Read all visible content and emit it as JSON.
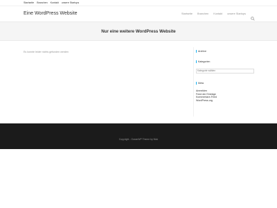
{
  "topbar": {
    "items": [
      {
        "label": "Startseite"
      },
      {
        "label": "Branchen"
      },
      {
        "label": "Kontakt"
      },
      {
        "label": "unsere Startups"
      }
    ]
  },
  "header": {
    "site_title": "Eine WordPress Website",
    "nav": [
      {
        "label": "Startseite"
      },
      {
        "label": "Branchen"
      },
      {
        "label": "Kontakt"
      },
      {
        "label": "unsere Startups"
      }
    ],
    "search_icon": "search-icon"
  },
  "page_header": {
    "title": "Nur eine weitere WordPress Website"
  },
  "content": {
    "notice": "Es konnte leider nichts gefunden werden"
  },
  "sidebar": {
    "archive_title": "Archive",
    "categories_title": "Kategorien",
    "categories_select": "Kategorie wählen",
    "meta_title": "Meta",
    "meta_items": [
      {
        "label": "Anmelden"
      },
      {
        "label": "Feed der Einträge"
      },
      {
        "label": "Kommentare-Feed"
      },
      {
        "label": "WordPress.org"
      }
    ]
  },
  "footer": {
    "copyright": "Copyright - OceanWP Theme by Nick"
  },
  "colors": {
    "accent": "#13aff0",
    "footer_bg": "#1b1b1b",
    "page_header_bg": "#f5f5f5"
  }
}
